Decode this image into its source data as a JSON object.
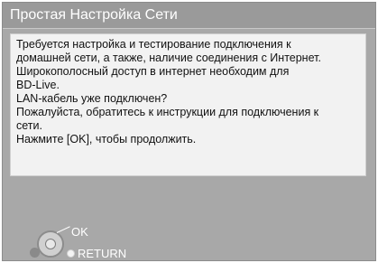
{
  "dialog": {
    "title": "Простая Настройка Сети",
    "message_lines": [
      "Требуется настройка и тестирование подключения  к",
      "домашней сети, а также, наличие соединения с Интернет.",
      "Широкополосный доступ в интернет необходим для",
      "BD-Live.",
      "LAN-кабель уже подключен?",
      "Пожалуйста, обратитесь к инструкции для подключения к",
      "сети.",
      "Нажмите [OK], чтобы продолжить."
    ]
  },
  "controls": {
    "ok_label": "OK",
    "return_label": "RETURN",
    "icons": [
      "dpad-icon",
      "return-dot-icon",
      "back-dot-icon"
    ]
  },
  "colors": {
    "background": "#a8a8a8",
    "title_bar": "#9a9a9a",
    "message_box": "#f2f2f2",
    "text_light": "#ffffff",
    "text_dark": "#111111"
  }
}
